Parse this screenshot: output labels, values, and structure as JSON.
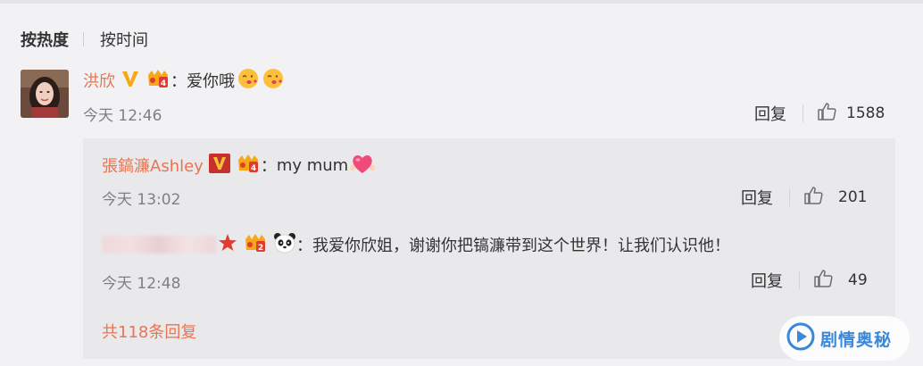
{
  "sort": {
    "hot": "按热度",
    "time": "按时间"
  },
  "comment": {
    "username": "洪欣",
    "colon": "：",
    "text": "爱你哦",
    "emoji": "kiss-face",
    "time": "今天 12:46",
    "reply_label": "回复",
    "likes": "1588"
  },
  "replies": [
    {
      "username": "張鎬濂Ashley",
      "colon": "：",
      "text": "my mum",
      "emoji": "pink-heart-hands",
      "time": "今天 13:02",
      "reply_label": "回复",
      "likes": "201"
    },
    {
      "username_obscured": true,
      "colon": "：",
      "text": "我爱你欣姐，谢谢你把镐濂带到这个世界！让我们认识他！",
      "time": "今天 12:48",
      "reply_label": "回复",
      "likes": "49"
    }
  ],
  "more_replies": "共118条回复",
  "watermark": "剧情奥秘",
  "colors": {
    "accent": "#eb7350",
    "verified_gold": "#f6a818",
    "verified_red": "#e03b2e",
    "watermark_blue": "#3b88d8"
  }
}
